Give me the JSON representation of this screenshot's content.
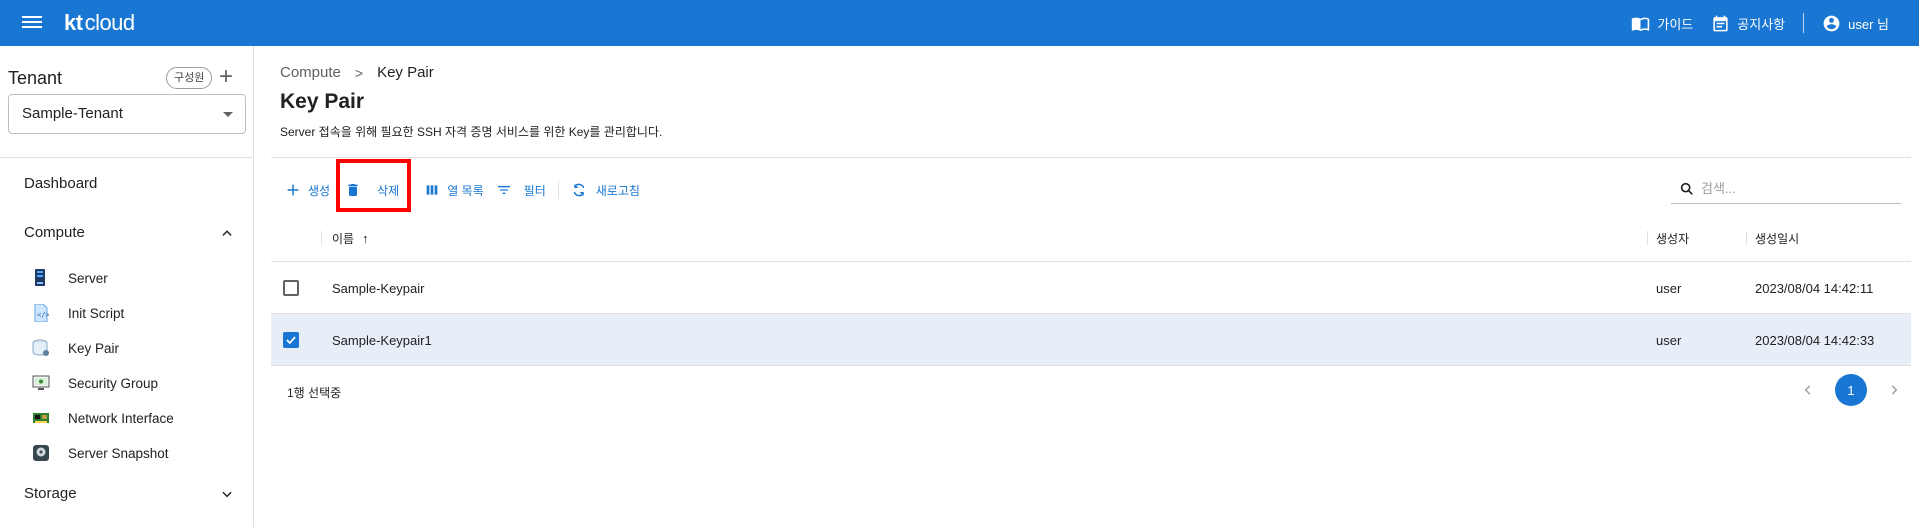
{
  "topbar": {
    "logo_kt": "kt",
    "logo_cloud": "cloud",
    "guide": "가이드",
    "notice": "공지사항",
    "user": "user 님"
  },
  "sidebar": {
    "tenant_title": "Tenant",
    "member_chip": "구성원",
    "add_icon": "+",
    "tenant_value": "Sample-Tenant",
    "dashboard": "Dashboard",
    "compute": "Compute",
    "storage": "Storage",
    "items": [
      {
        "label": "Server",
        "icon": "server-icon"
      },
      {
        "label": "Init Script",
        "icon": "script-icon"
      },
      {
        "label": "Key Pair",
        "icon": "key-pair-icon"
      },
      {
        "label": "Security Group",
        "icon": "security-group-icon"
      },
      {
        "label": "Network Interface",
        "icon": "network-interface-icon"
      },
      {
        "label": "Server Snapshot",
        "icon": "snapshot-icon"
      }
    ]
  },
  "breadcrumb": {
    "root": "Compute",
    "sep": ">",
    "current": "Key Pair"
  },
  "page": {
    "title": "Key Pair",
    "description": "Server 접속을 위해 필요한 SSH 자격 증명 서비스를 위한 Key를 관리합니다."
  },
  "toolbar": {
    "create": "생성",
    "delete": "삭제",
    "columns": "열 목록",
    "filter": "필터",
    "refresh": "새로고침"
  },
  "search": {
    "placeholder": "검색..."
  },
  "table": {
    "headers": {
      "name": "이름",
      "creator": "생성자",
      "created": "생성일시"
    },
    "sort_arrow": "↑",
    "rows": [
      {
        "name": "Sample-Keypair",
        "creator": "user",
        "created": "2023/08/04 14:42:11",
        "checked": false
      },
      {
        "name": "Sample-Keypair1",
        "creator": "user",
        "created": "2023/08/04 14:42:33",
        "checked": true
      }
    ]
  },
  "footer": {
    "selection": "1행 선택중",
    "page": "1"
  },
  "colors": {
    "primary": "#1976d2",
    "highlight": "#ff0000",
    "selected_row": "#e8eef8"
  }
}
